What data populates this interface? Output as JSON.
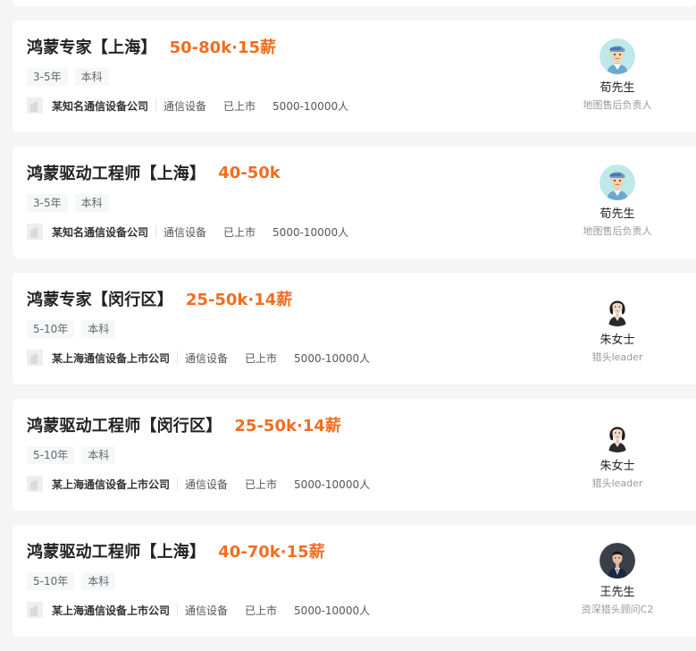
{
  "jobs": [
    {
      "title": "鸿蒙专家【上海】",
      "salary": "50-80k·15薪",
      "tags": [
        "3-5年",
        "本科"
      ],
      "company": {
        "name": "某知名通信设备公司",
        "industry": "通信设备",
        "stage": "已上市",
        "size": "5000-10000人"
      },
      "recruiter": {
        "name": "荀先生",
        "role": "地图售后负责人",
        "avatar": "cartoon-man-avatar"
      }
    },
    {
      "title": "鸿蒙驱动工程师【上海】",
      "salary": "40-50k",
      "tags": [
        "3-5年",
        "本科"
      ],
      "company": {
        "name": "某知名通信设备公司",
        "industry": "通信设备",
        "stage": "已上市",
        "size": "5000-10000人"
      },
      "recruiter": {
        "name": "荀先生",
        "role": "地图售后负责人",
        "avatar": "cartoon-man-avatar"
      }
    },
    {
      "title": "鸿蒙专家【闵行区】",
      "salary": "25-50k·14薪",
      "tags": [
        "5-10年",
        "本科"
      ],
      "company": {
        "name": "某上海通信设备上市公司",
        "industry": "通信设备",
        "stage": "已上市",
        "size": "5000-10000人"
      },
      "recruiter": {
        "name": "朱女士",
        "role": "猎头leader",
        "avatar": "woman-photo-avatar"
      }
    },
    {
      "title": "鸿蒙驱动工程师【闵行区】",
      "salary": "25-50k·14薪",
      "tags": [
        "5-10年",
        "本科"
      ],
      "company": {
        "name": "某上海通信设备上市公司",
        "industry": "通信设备",
        "stage": "已上市",
        "size": "5000-10000人"
      },
      "recruiter": {
        "name": "朱女士",
        "role": "猎头leader",
        "avatar": "woman-photo-avatar"
      }
    },
    {
      "title": "鸿蒙驱动工程师【上海】",
      "salary": "40-70k·15薪",
      "tags": [
        "5-10年",
        "本科"
      ],
      "company": {
        "name": "某上海通信设备上市公司",
        "industry": "通信设备",
        "stage": "已上市",
        "size": "5000-10000人"
      },
      "recruiter": {
        "name": "王先生",
        "role": "资深猎头顾问C2",
        "avatar": "man-suit-photo-avatar"
      }
    }
  ],
  "colors": {
    "salary": "#f26d21",
    "page_background": "#f5f5f6",
    "card_background": "#ffffff"
  }
}
